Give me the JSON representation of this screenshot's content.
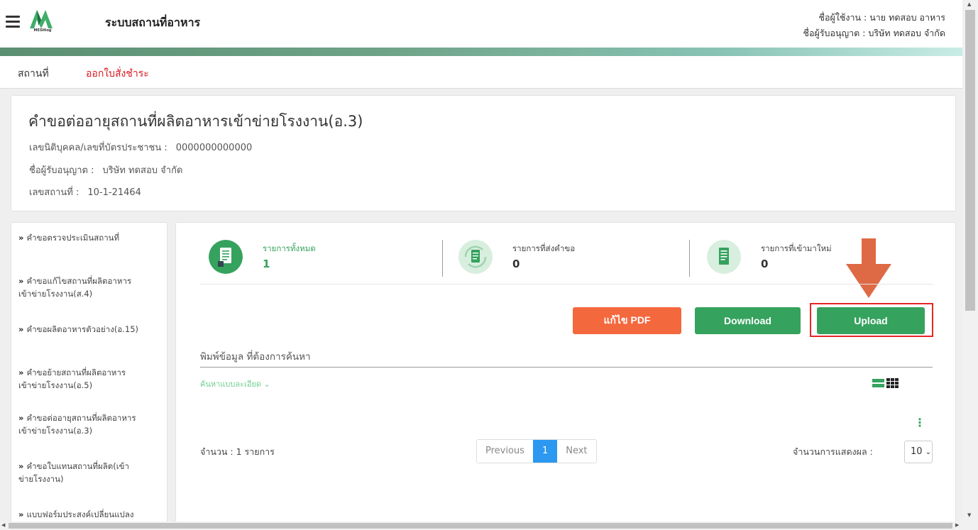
{
  "header": {
    "logo_text": "MESHlog",
    "app_title": "ระบบสถานที่อาหาร",
    "user_line": "ชื่อผู้ใช้งาน : นาย ทดสอบ อาหาร",
    "licensee_line": "ชื่อผู้รับอนุญาต : บริษัท ทดสอบ จำกัด"
  },
  "nav": {
    "place": "สถานที่",
    "payment": "ออกใบสั่งชำระ"
  },
  "info": {
    "title": "คำขอต่ออายุสถานที่ผลิตอาหารเข้าข่ายโรงงาน(อ.3)",
    "id_label": "เลขนิติบุคคล/เลขที่บัตรประชาชน :",
    "id_value": "0000000000000",
    "licensee_label": "ชื่อผู้รับอนุญาต :",
    "licensee_value": "บริษัท ทดสอบ จำกัด",
    "place_no_label": "เลขสถานที่ :",
    "place_no_value": "10-1-21464"
  },
  "sidebar": {
    "items": [
      {
        "line1": "คำขอตรวจประเมินสถานที่",
        "line2": ""
      },
      {
        "line1": "คำขอแก้ไขสถานที่ผลิตอาหาร",
        "line2": "เข้าข่ายโรงงาน(ส.4)"
      },
      {
        "line1": "คำขอผลิตอาหารตัวอย่าง(อ.15)",
        "line2": ""
      },
      {
        "line1": "คำขอย้ายสถานที่ผลิตอาหาร",
        "line2": "เข้าข่ายโรงงาน(อ.5)"
      },
      {
        "line1": "คำขอต่ออายุสถานที่ผลิตอาหาร",
        "line2": "เข้าข่ายโรงงาน(อ.3)"
      },
      {
        "line1": "คำขอใบแทนสถานที่ผลิต(เข้า",
        "line2": "ข่ายโรงงาน)"
      },
      {
        "line1": "แบบฟอร์มประสงค์เปลี่ยนแปลง",
        "line2": ""
      }
    ]
  },
  "stats": [
    {
      "label": "รายการทั้งหมด",
      "value": "1",
      "label_color": "#35a25e"
    },
    {
      "label": "รายการที่ส่งคำขอ",
      "value": "0",
      "label_color": "#444444"
    },
    {
      "label": "รายการที่เข้ามาใหม่",
      "value": "0",
      "label_color": "#444444"
    }
  ],
  "buttons": {
    "edit_pdf": "แก้ไข PDF",
    "download": "Download",
    "upload": "Upload"
  },
  "search": {
    "placeholder": "พิมพ์ข้อมูล ที่ต้องการค้นหา",
    "advanced": "ค้นหาแบบละเอียด ⌄"
  },
  "table": {
    "count_text": "จำนวน : 1 รายการ",
    "pagination": {
      "previous": "Previous",
      "current": "1",
      "next": "Next"
    },
    "rows_label": "จำนวนการแสดงผล :",
    "rows_value": "10"
  },
  "colors": {
    "brand_green": "#35a25e",
    "orange": "#f4683e",
    "highlight_red": "#e52727",
    "arrow": "#de6a45"
  }
}
